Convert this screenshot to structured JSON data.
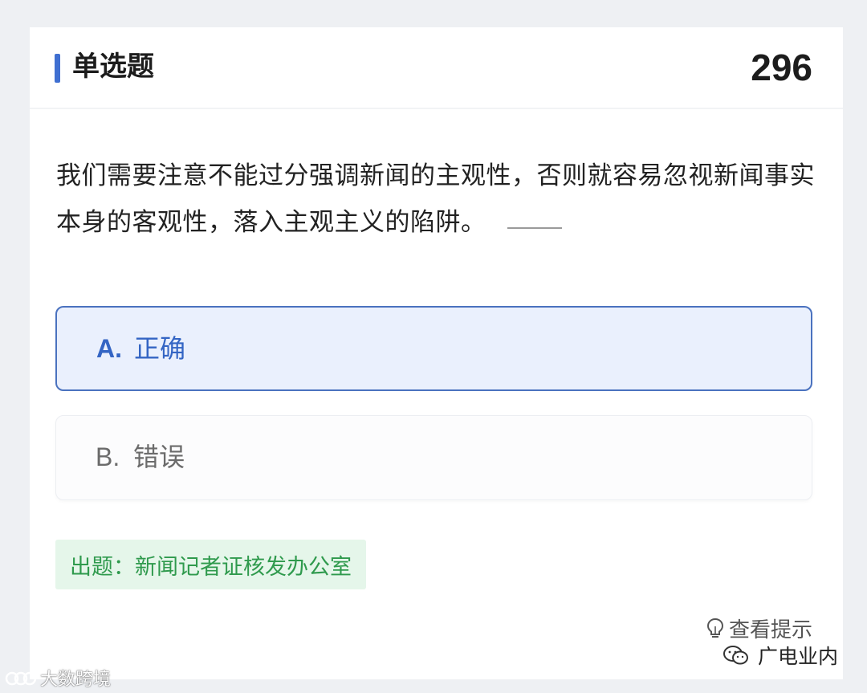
{
  "header": {
    "type_label": "单选题",
    "question_number": "296"
  },
  "question": {
    "text": "我们需要注意不能过分强调新闻的主观性，否则就容易忽视新闻事实本身的客观性，落入主观主义的陷阱。"
  },
  "options": [
    {
      "letter": "A.",
      "text": "正确",
      "selected": true
    },
    {
      "letter": "B.",
      "text": "错误",
      "selected": false
    }
  ],
  "source": {
    "text": "出题：新闻记者证核发办公室"
  },
  "hint": {
    "label": "查看提示",
    "icon": "lightbulb-icon"
  },
  "watermarks": {
    "left": "大数跨境",
    "right": "广电业内"
  },
  "colors": {
    "accent": "#3f6fd1",
    "selected_bg": "#eaf0fd",
    "selected_border": "#4a72bf",
    "source_bg": "#e5f6ea",
    "source_text": "#2f9a4d"
  }
}
